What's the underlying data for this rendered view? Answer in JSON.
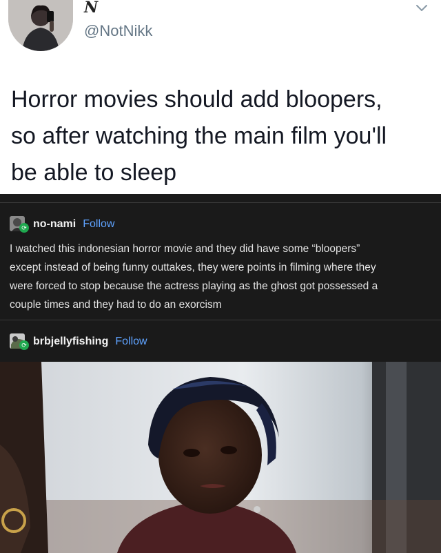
{
  "tweet": {
    "display_name": "N",
    "handle": "@NotNikk",
    "text_lines": [
      "Horror movies should add bloopers,",
      "so after watching the main film you'll",
      "be able to sleep"
    ],
    "icons": {
      "avatar": "user-avatar",
      "menu": "chevron-down-icon"
    }
  },
  "thread": {
    "posts": [
      {
        "username": "no-nami",
        "follow_label": "Follow",
        "body_lines": [
          "I watched this indonesian horror movie and they did have some “bloopers”",
          "except instead of being funny outtakes, they were points in filming where they",
          "were forced to stop because the actress playing as the ghost got possessed a",
          "couple times and they had to do an exorcism"
        ]
      },
      {
        "username": "brbjellyfishing",
        "follow_label": "Follow"
      }
    ],
    "icons": {
      "reblog": "reblog-icon"
    },
    "colors": {
      "follow": "#5fa3ff",
      "reblog": "#1fa84f"
    }
  }
}
